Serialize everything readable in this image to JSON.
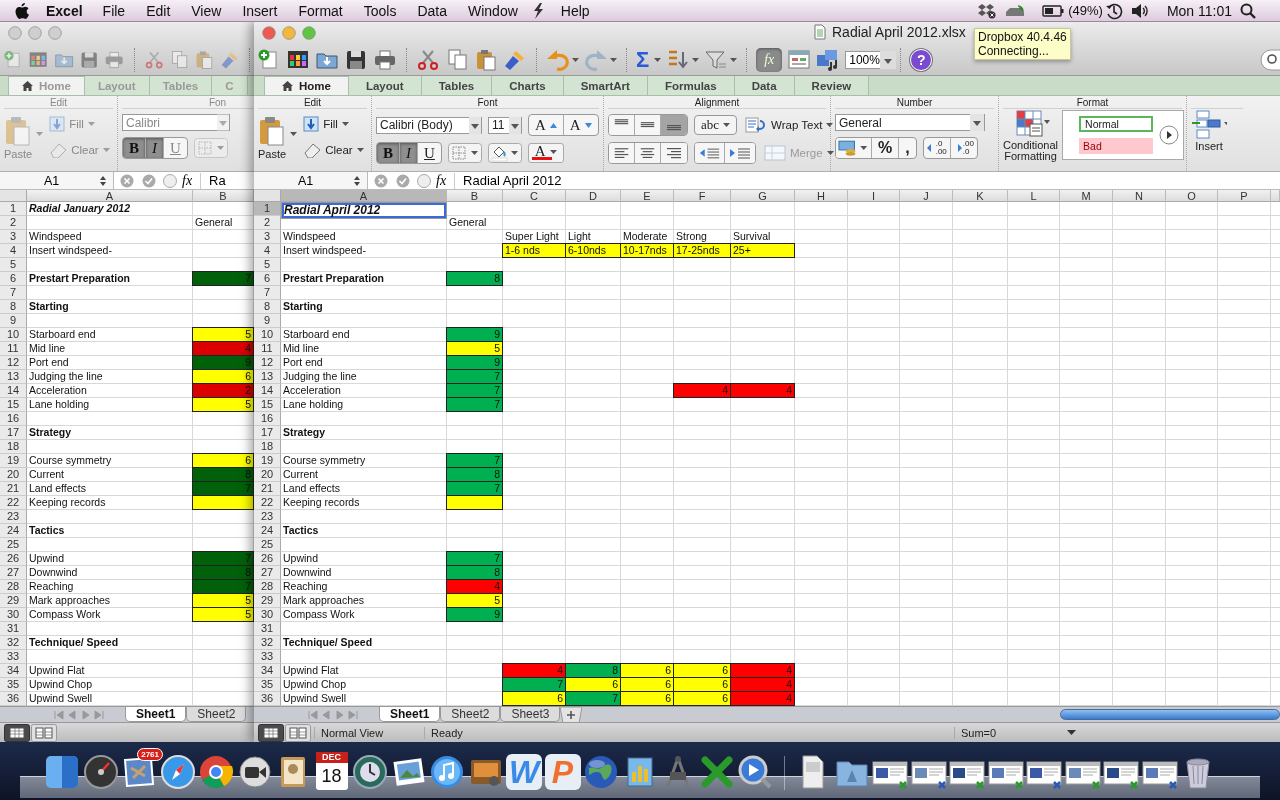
{
  "menubar": {
    "app": "Excel",
    "menus": [
      {
        "kind": "text",
        "label": "File"
      },
      {
        "kind": "text",
        "label": "Edit"
      },
      {
        "kind": "text",
        "label": "View"
      },
      {
        "kind": "text",
        "label": "Insert"
      },
      {
        "kind": "text",
        "label": "Format"
      },
      {
        "kind": "text",
        "label": "Tools"
      },
      {
        "kind": "text",
        "label": "Data"
      },
      {
        "kind": "text",
        "label": "Window"
      },
      {
        "kind": "icon"
      },
      {
        "kind": "text",
        "label": "Help"
      }
    ],
    "battery": "(49%)",
    "clock": "Mon 11:01"
  },
  "tooltip": [
    "Dropbox 40.4.46",
    "Connecting..."
  ],
  "windows": [
    {
      "active": false,
      "tabs": [
        {
          "label": "Home",
          "selected": true
        },
        {
          "label": "Layout",
          "selected": false
        },
        {
          "label": "Tables",
          "selected": false
        },
        {
          "label": "C",
          "selected": false
        }
      ],
      "ribbon": {
        "edit": {
          "title": "Edit",
          "paste": "Paste",
          "fill": "Fill",
          "clear": "Clear"
        },
        "font": {
          "title": "Fon",
          "face": "Calibri",
          "bold": {
            "label": "B",
            "on": true
          },
          "italic": {
            "label": "I",
            "on": true
          },
          "underline": {
            "label": "U",
            "on": false
          }
        }
      },
      "name_box": "A1",
      "fx_label": "fx",
      "formula": "Ra",
      "columns": [
        "A",
        "B"
      ],
      "rows": [
        {
          "n": "1",
          "A": {
            "text": "Radial January 2012",
            "kind": "title",
            "selected": false
          }
        },
        {
          "n": "2",
          "B": {
            "text": "General"
          }
        },
        {
          "n": "3",
          "A": {
            "text": "Windspeed"
          }
        },
        {
          "n": "4",
          "A": {
            "text": "Insert windspeed-"
          }
        },
        {
          "n": "5"
        },
        {
          "n": "6",
          "A": {
            "text": "Prestart Preparation",
            "kind": "heading"
          },
          "B": {
            "text": "7",
            "kind": "number",
            "color": "#00610a"
          }
        },
        {
          "n": "7"
        },
        {
          "n": "8",
          "A": {
            "text": "Starting",
            "kind": "heading"
          }
        },
        {
          "n": "9"
        },
        {
          "n": "10",
          "A": {
            "text": "Starboard end"
          },
          "B": {
            "text": "5",
            "kind": "number",
            "color": "#ffff00"
          }
        },
        {
          "n": "11",
          "A": {
            "text": "Mid line"
          },
          "B": {
            "text": "4",
            "kind": "number",
            "color": "#dd0000"
          }
        },
        {
          "n": "12",
          "A": {
            "text": "Port end"
          },
          "B": {
            "text": "9",
            "kind": "number",
            "color": "#00610a"
          }
        },
        {
          "n": "13",
          "A": {
            "text": "Judging the line"
          },
          "B": {
            "text": "6",
            "kind": "number",
            "color": "#ffff00"
          }
        },
        {
          "n": "14",
          "A": {
            "text": "Acceleration"
          },
          "B": {
            "text": "2",
            "kind": "number",
            "color": "#dd0000"
          }
        },
        {
          "n": "15",
          "A": {
            "text": "Lane holding"
          },
          "B": {
            "text": "5",
            "kind": "number",
            "color": "#ffff00"
          }
        },
        {
          "n": "16"
        },
        {
          "n": "17",
          "A": {
            "text": "Strategy",
            "kind": "heading"
          }
        },
        {
          "n": "18"
        },
        {
          "n": "19",
          "A": {
            "text": "Course symmetry"
          },
          "B": {
            "text": "6",
            "kind": "number",
            "color": "#ffff00"
          }
        },
        {
          "n": "20",
          "A": {
            "text": "Current"
          },
          "B": {
            "text": "8",
            "kind": "number",
            "color": "#00610a"
          }
        },
        {
          "n": "21",
          "A": {
            "text": "Land effects"
          },
          "B": {
            "text": "7",
            "kind": "number",
            "color": "#00610a"
          }
        },
        {
          "n": "22",
          "A": {
            "text": "Keeping records"
          },
          "B": {
            "color": "#ffff00"
          }
        },
        {
          "n": "23"
        },
        {
          "n": "24",
          "A": {
            "text": "Tactics",
            "kind": "heading"
          }
        },
        {
          "n": "25"
        },
        {
          "n": "26",
          "A": {
            "text": "Upwind"
          },
          "B": {
            "text": "7",
            "kind": "number",
            "color": "#00610a"
          }
        },
        {
          "n": "27",
          "A": {
            "text": "Downwind"
          },
          "B": {
            "text": "8",
            "kind": "number",
            "color": "#00610a"
          }
        },
        {
          "n": "28",
          "A": {
            "text": "Reaching"
          },
          "B": {
            "text": "7",
            "kind": "number",
            "color": "#00610a"
          }
        },
        {
          "n": "29",
          "A": {
            "text": "Mark approaches"
          },
          "B": {
            "text": "5",
            "kind": "number",
            "color": "#ffff00"
          }
        },
        {
          "n": "30",
          "A": {
            "text": "Compass Work"
          },
          "B": {
            "text": "5",
            "kind": "number",
            "color": "#ffff00"
          }
        },
        {
          "n": "31"
        },
        {
          "n": "32",
          "A": {
            "text": "Technique/ Speed",
            "kind": "heading"
          }
        },
        {
          "n": "33"
        },
        {
          "n": "34",
          "A": {
            "text": "Upwind Flat"
          }
        },
        {
          "n": "35",
          "A": {
            "text": "Upwind Chop"
          }
        },
        {
          "n": "36",
          "A": {
            "text": "Upwind Swell"
          }
        }
      ],
      "sheets": [
        {
          "label": "Sheet1",
          "selected": true
        },
        {
          "label": "Sheet2",
          "selected": false
        }
      ],
      "view_buttons": [
        {
          "selected": true
        },
        {
          "selected": false
        }
      ]
    },
    {
      "active": true,
      "title": "Radial April 2012.xlsx",
      "toolbar": {
        "sum": "Σ",
        "fx": "fx",
        "fx_on": true,
        "zoom": "100%",
        "help": "?"
      },
      "tabs": [
        {
          "label": "Home",
          "selected": true
        },
        {
          "label": "Layout",
          "selected": false
        },
        {
          "label": "Tables",
          "selected": false
        },
        {
          "label": "Charts",
          "selected": false
        },
        {
          "label": "SmartArt",
          "selected": false
        },
        {
          "label": "Formulas",
          "selected": false
        },
        {
          "label": "Data",
          "selected": false
        },
        {
          "label": "Review",
          "selected": false
        }
      ],
      "ribbon": {
        "edit": {
          "title": "Edit",
          "paste": "Paste",
          "fill": "Fill",
          "clear": "Clear"
        },
        "font": {
          "title": "Font",
          "face": "Calibri (Body)",
          "size": "11",
          "grow": "A",
          "shrink": "A",
          "bold": {
            "label": "B",
            "on": true
          },
          "italic": {
            "label": "I",
            "on": true
          },
          "underline": {
            "label": "U",
            "on": false
          },
          "font_color_label": "A"
        },
        "alignment": {
          "title": "Alignment",
          "valign": [
            {
              "selected": false
            },
            {
              "selected": false
            },
            {
              "selected": true
            }
          ],
          "orientation": "abc",
          "wrap": "Wrap Text",
          "merge": {
            "label": "Merge",
            "disabled": true
          }
        },
        "number": {
          "title": "Number",
          "format": "General",
          "percent": "%",
          "comma": ",",
          "decimals": [
            ".0\n.00",
            ".00\n.0"
          ]
        },
        "format": {
          "title": "Format",
          "conditional": "Conditional Formatting",
          "styles": [
            {
              "label": "Normal",
              "kind": "normal",
              "selected": true
            },
            {
              "label": "Bad",
              "kind": "bad",
              "selected": false
            }
          ]
        },
        "insert": "Insert"
      },
      "name_box": "A1",
      "fx_label": "fx",
      "formula": "Radial April 2012",
      "columns": [
        "A",
        "B",
        "C",
        "D",
        "E",
        "F",
        "G",
        "H",
        "I",
        "J",
        "K",
        "L",
        "M",
        "N",
        "O",
        "P"
      ],
      "rows": [
        {
          "n": "1",
          "A": {
            "text": "Radial April 2012",
            "kind": "title",
            "selected": true
          }
        },
        {
          "n": "2",
          "B": {
            "text": "General"
          }
        },
        {
          "n": "3",
          "A": {
            "text": "Windspeed"
          },
          "C": {
            "text": "Super Light"
          },
          "D": {
            "text": "Light"
          },
          "E": {
            "text": "Moderate"
          },
          "F": {
            "text": "Strong"
          },
          "G": {
            "text": "Survival"
          }
        },
        {
          "n": "4",
          "A": {
            "text": "Insert windspeed-"
          },
          "C": {
            "text": "1-6 nds",
            "color": "#ffff00"
          },
          "D": {
            "text": "6-10nds",
            "color": "#ffff00"
          },
          "E": {
            "text": "10-17nds",
            "color": "#ffff00"
          },
          "F": {
            "text": "17-25nds",
            "color": "#ffff00"
          },
          "G": {
            "text": "25+",
            "color": "#ffff00"
          }
        },
        {
          "n": "5"
        },
        {
          "n": "6",
          "A": {
            "text": "Prestart Preparation",
            "kind": "heading"
          },
          "B": {
            "text": "8",
            "kind": "number",
            "color": "#00b050"
          }
        },
        {
          "n": "7"
        },
        {
          "n": "8",
          "A": {
            "text": "Starting",
            "kind": "heading"
          }
        },
        {
          "n": "9"
        },
        {
          "n": "10",
          "A": {
            "text": "Starboard end"
          },
          "B": {
            "text": "9",
            "kind": "number",
            "color": "#00b050"
          }
        },
        {
          "n": "11",
          "A": {
            "text": "Mid line"
          },
          "B": {
            "text": "5",
            "kind": "number",
            "color": "#ffff00"
          }
        },
        {
          "n": "12",
          "A": {
            "text": "Port end"
          },
          "B": {
            "text": "9",
            "kind": "number",
            "color": "#00b050"
          }
        },
        {
          "n": "13",
          "A": {
            "text": "Judging the line"
          },
          "B": {
            "text": "7",
            "kind": "number",
            "color": "#00b050"
          }
        },
        {
          "n": "14",
          "A": {
            "text": "Acceleration"
          },
          "B": {
            "text": "7",
            "kind": "number",
            "color": "#00b050"
          },
          "F": {
            "text": "4",
            "kind": "number",
            "color": "#ff0000"
          },
          "G": {
            "text": "4",
            "kind": "number",
            "color": "#ff0000"
          }
        },
        {
          "n": "15",
          "A": {
            "text": "Lane holding"
          },
          "B": {
            "text": "7",
            "kind": "number",
            "color": "#00b050"
          }
        },
        {
          "n": "16"
        },
        {
          "n": "17",
          "A": {
            "text": "Strategy",
            "kind": "heading"
          }
        },
        {
          "n": "18"
        },
        {
          "n": "19",
          "A": {
            "text": "Course symmetry"
          },
          "B": {
            "text": "7",
            "kind": "number",
            "color": "#00b050"
          }
        },
        {
          "n": "20",
          "A": {
            "text": "Current"
          },
          "B": {
            "text": "8",
            "kind": "number",
            "color": "#00b050"
          }
        },
        {
          "n": "21",
          "A": {
            "text": "Land effects"
          },
          "B": {
            "text": "7",
            "kind": "number",
            "color": "#00b050"
          }
        },
        {
          "n": "22",
          "A": {
            "text": "Keeping records"
          },
          "B": {
            "color": "#ffff00"
          }
        },
        {
          "n": "23"
        },
        {
          "n": "24",
          "A": {
            "text": "Tactics",
            "kind": "heading"
          }
        },
        {
          "n": "25"
        },
        {
          "n": "26",
          "A": {
            "text": "Upwind"
          },
          "B": {
            "text": "7",
            "kind": "number",
            "color": "#00b050"
          }
        },
        {
          "n": "27",
          "A": {
            "text": "Downwind"
          },
          "B": {
            "text": "8",
            "kind": "number",
            "color": "#00b050"
          }
        },
        {
          "n": "28",
          "A": {
            "text": "Reaching"
          },
          "B": {
            "text": "4",
            "kind": "number",
            "color": "#ff0000"
          }
        },
        {
          "n": "29",
          "A": {
            "text": "Mark approaches"
          },
          "B": {
            "text": "5",
            "kind": "number",
            "color": "#ffff00"
          }
        },
        {
          "n": "30",
          "A": {
            "text": "Compass Work"
          },
          "B": {
            "text": "9",
            "kind": "number",
            "color": "#00b050"
          }
        },
        {
          "n": "31"
        },
        {
          "n": "32",
          "A": {
            "text": "Technique/ Speed",
            "kind": "heading"
          }
        },
        {
          "n": "33"
        },
        {
          "n": "34",
          "A": {
            "text": "Upwind Flat"
          },
          "C": {
            "text": "4",
            "kind": "number",
            "color": "#ff0000"
          },
          "D": {
            "text": "8",
            "kind": "number",
            "color": "#00b050"
          },
          "E": {
            "text": "6",
            "kind": "number",
            "color": "#ffff00"
          },
          "F": {
            "text": "6",
            "kind": "number",
            "color": "#ffff00"
          },
          "G": {
            "text": "4",
            "kind": "number",
            "color": "#ff0000"
          }
        },
        {
          "n": "35",
          "A": {
            "text": "Upwind Chop"
          },
          "C": {
            "text": "7",
            "kind": "number",
            "color": "#00b050"
          },
          "D": {
            "text": "6",
            "kind": "number",
            "color": "#ffff00"
          },
          "E": {
            "text": "6",
            "kind": "number",
            "color": "#ffff00"
          },
          "F": {
            "text": "6",
            "kind": "number",
            "color": "#ffff00"
          },
          "G": {
            "text": "4",
            "kind": "number",
            "color": "#ff0000"
          }
        },
        {
          "n": "36",
          "A": {
            "text": "Upwind Swell"
          },
          "C": {
            "text": "6",
            "kind": "number",
            "color": "#ffff00"
          },
          "D": {
            "text": "7",
            "kind": "number",
            "color": "#00b050"
          },
          "E": {
            "text": "6",
            "kind": "number",
            "color": "#ffff00"
          },
          "F": {
            "text": "6",
            "kind": "number",
            "color": "#ffff00"
          },
          "G": {
            "text": "4",
            "kind": "number",
            "color": "#ff0000"
          }
        }
      ],
      "sheets": [
        {
          "label": "Sheet1",
          "selected": true
        },
        {
          "label": "Sheet2",
          "selected": false
        },
        {
          "label": "Sheet3",
          "selected": false
        }
      ],
      "add_sheet_button": true,
      "view_buttons": [
        {
          "selected": true
        },
        {
          "selected": false
        }
      ],
      "status": {
        "view": "Normal View",
        "state": "Ready",
        "sum": "Sum=0"
      }
    }
  ],
  "dock": {
    "mail_badge": "2761",
    "calendar_month": "DEC",
    "calendar_day": "18",
    "word": "W",
    "powerpoint": "P"
  }
}
